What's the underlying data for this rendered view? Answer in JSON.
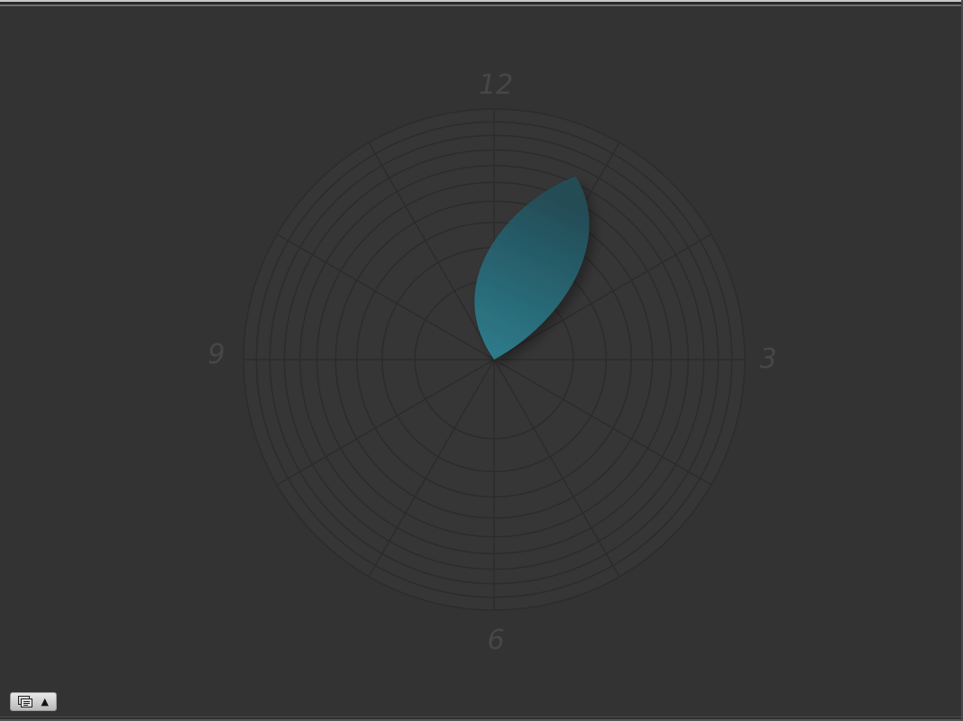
{
  "clock": {
    "hour_labels": {
      "twelve": "12",
      "three": "3",
      "six": "6",
      "nine": "9"
    },
    "ring_count": 10,
    "spoke_count": 12,
    "petal": {
      "direction_hours": 0.8,
      "extent_fraction": 0.8,
      "color": "#2b7f90"
    },
    "colors": {
      "background": "#333333",
      "face": "#363636",
      "grid": "#2c2c2c",
      "label": "#474747"
    }
  },
  "toolbar": {
    "toggle_icon": "window-icon",
    "toggle_caret": "▲"
  }
}
